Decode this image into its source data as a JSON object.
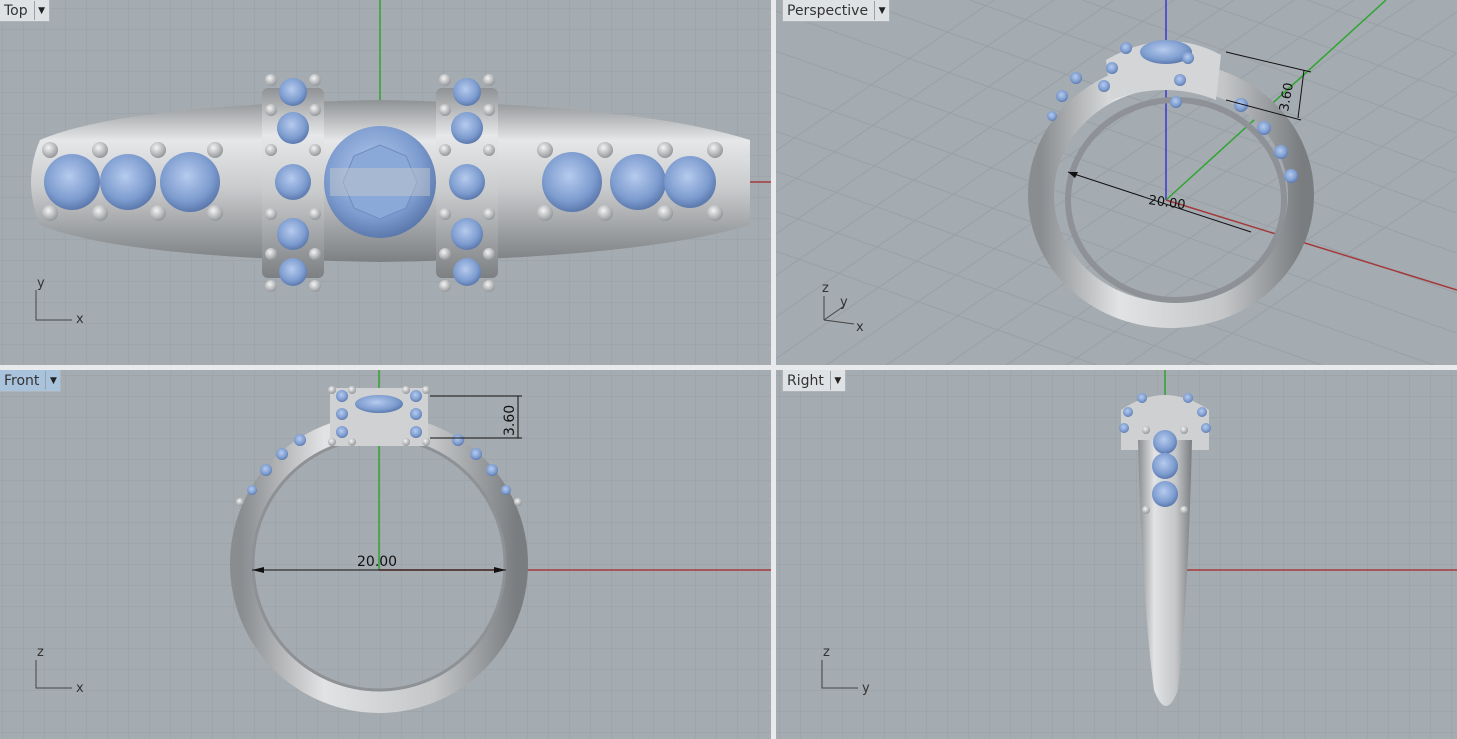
{
  "viewports": {
    "top": {
      "title": "Top",
      "axis_h": "x",
      "axis_v": "y"
    },
    "persp": {
      "title": "Perspective",
      "axis_1": "z",
      "axis_2": "y",
      "axis_3": "x",
      "dim_width": "20.00",
      "dim_height": "3.60"
    },
    "front": {
      "title": "Front",
      "axis_h": "x",
      "axis_v": "z",
      "dim_width": "20.00",
      "dim_height": "3.60"
    },
    "right": {
      "title": "Right",
      "axis_h": "y",
      "axis_v": "z"
    }
  },
  "colors": {
    "viewport_bg": "#a4abb1",
    "grid_line": "#97a0a6",
    "axis_x": "#a33a3a",
    "axis_y": "#2ea52e",
    "axis_z": "#3a3ad0",
    "metal": "#c9cbcd",
    "gem": "#7f9fd1",
    "active_title": "#aac3dd"
  },
  "icons": {
    "dropdown": "chevron-down-icon"
  }
}
